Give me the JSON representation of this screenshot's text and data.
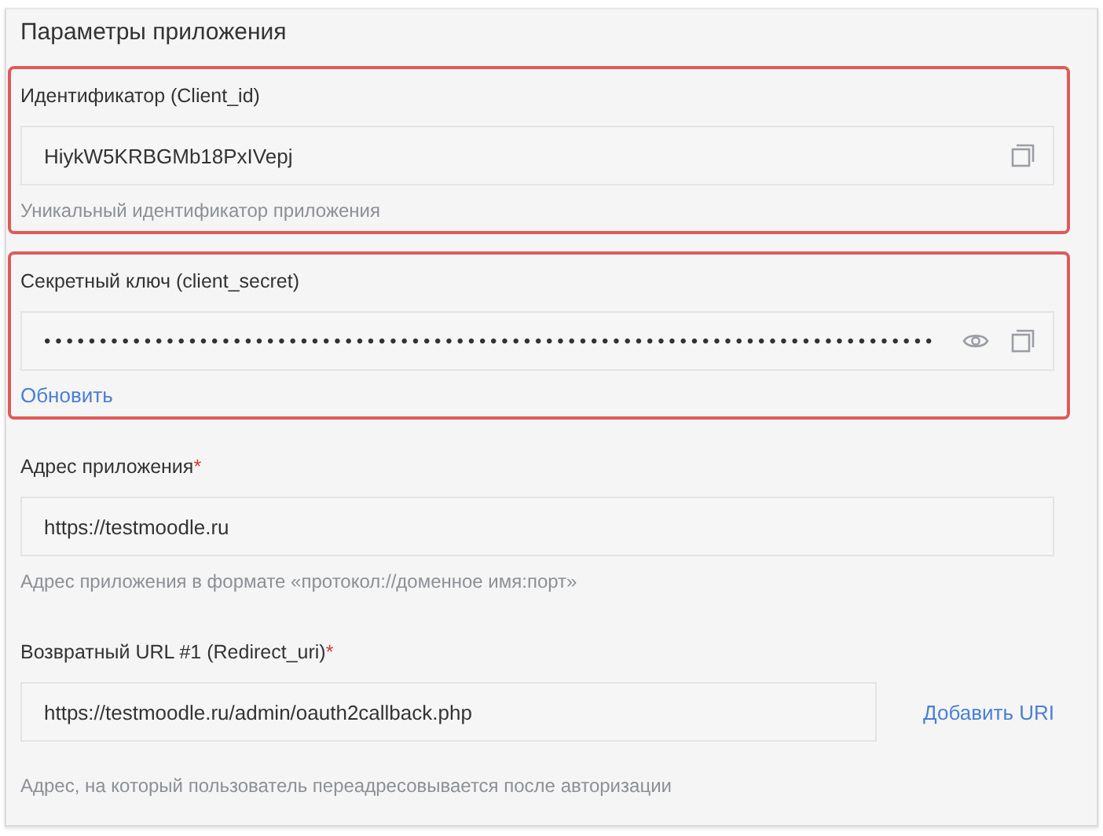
{
  "panel": {
    "title": "Параметры приложения"
  },
  "fields": [
    {
      "label": "Идентификатор (Client_id)",
      "highlighted": true,
      "value": "HiykW5KRBGMb18PxIVepj",
      "reveal_button": false,
      "copy_button": true,
      "helper": "Уникальный идентификатор приложения"
    },
    {
      "label": "Секретный ключ (client_secret)",
      "highlighted": true,
      "value": "••••••••••••••••••••••••••••••••••••••••••••••••••••••••••••••••••••••••••••••••",
      "reveal_button": true,
      "copy_button": true,
      "link": "Обновить"
    },
    {
      "label": "Адрес приложения",
      "required_mark": "*",
      "highlighted": false,
      "value": "https://testmoodle.ru",
      "reveal_button": false,
      "copy_button": false,
      "helper": "Адрес приложения в формате «протокол://доменное имя:порт»"
    },
    {
      "label": "Возвратный URL #1 (Redirect_uri)",
      "required_mark": "*",
      "highlighted": false,
      "value": "https://testmoodle.ru/admin/oauth2callback.php",
      "reveal_button": false,
      "copy_button": false,
      "side_link": "Добавить URI",
      "helper": "Адрес, на который пользователь переадресовывается после авторизации"
    }
  ]
}
